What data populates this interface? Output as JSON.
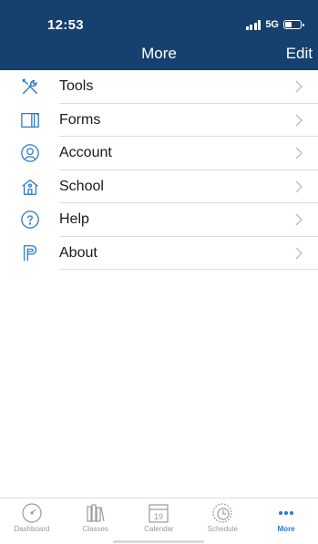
{
  "status_bar": {
    "time": "12:53",
    "network": "5G"
  },
  "header": {
    "title": "More",
    "edit_label": "Edit"
  },
  "menu": {
    "items": [
      {
        "label": "Tools",
        "icon": "tools-icon"
      },
      {
        "label": "Forms",
        "icon": "forms-icon"
      },
      {
        "label": "Account",
        "icon": "account-icon"
      },
      {
        "label": "School",
        "icon": "school-icon"
      },
      {
        "label": "Help",
        "icon": "help-icon"
      },
      {
        "label": "About",
        "icon": "about-icon"
      }
    ]
  },
  "tabbar": {
    "tabs": [
      {
        "label": "Dashboard",
        "icon": "dashboard-icon",
        "active": false
      },
      {
        "label": "Classes",
        "icon": "classes-icon",
        "active": false
      },
      {
        "label": "Calendar",
        "icon": "calendar-icon",
        "active": false,
        "date": "19"
      },
      {
        "label": "Schedule",
        "icon": "schedule-icon",
        "active": false
      },
      {
        "label": "More",
        "icon": "more-icon",
        "active": true
      }
    ]
  },
  "colors": {
    "header_bg": "#16406e",
    "icon_blue": "#2a79c9",
    "active_tab": "#2a79c9",
    "inactive_tab": "#9a9a9a"
  }
}
